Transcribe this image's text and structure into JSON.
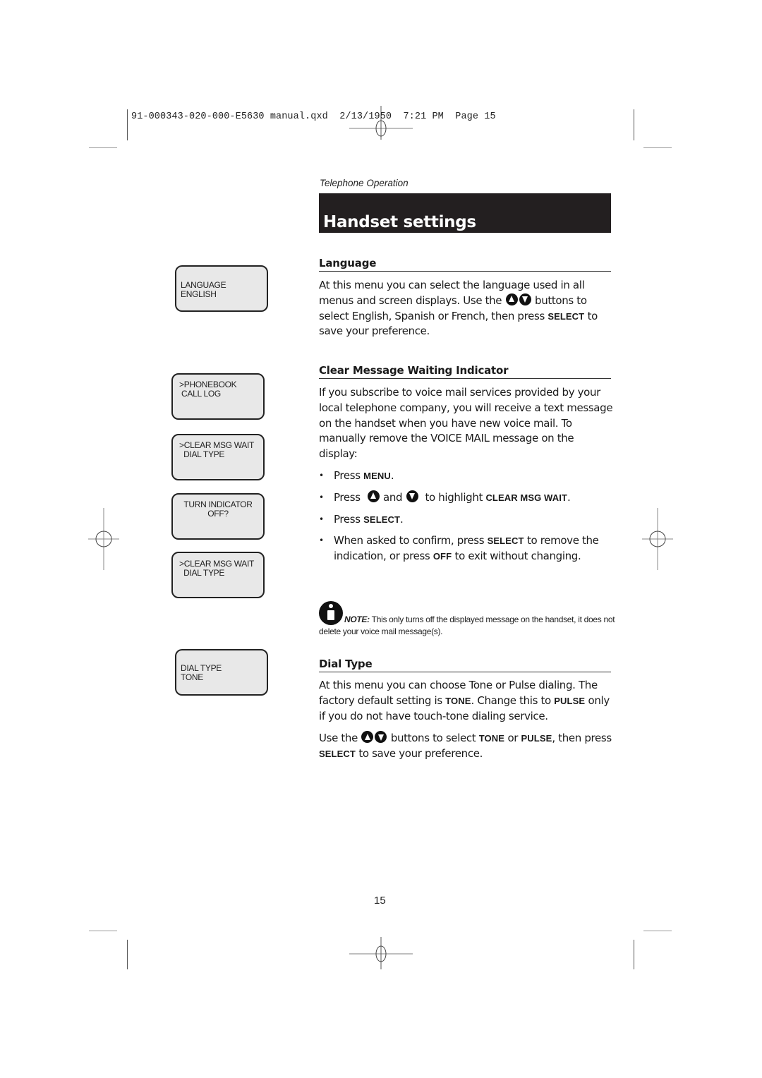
{
  "slug": "91-000343-020-000-E5630 manual.qxd  2/13/1950  7:21 PM  Page 15",
  "section_kicker": "Telephone Operation",
  "title": "Handset settings",
  "lcd_screens": [
    {
      "line1": "LANGUAGE",
      "line2": "ENGLISH"
    },
    {
      "line1": ">PHONEBOOK",
      "line2": " CALL LOG"
    },
    {
      "line1": ">CLEAR MSG WAIT",
      "line2": "  DIAL TYPE"
    },
    {
      "line1": "TURN INDICATOR",
      "line2": "OFF?"
    },
    {
      "line1": ">CLEAR MSG WAIT",
      "line2": "  DIAL TYPE"
    },
    {
      "line1": "DIAL TYPE",
      "line2": "TONE"
    }
  ],
  "language": {
    "heading": "Language",
    "p1": "At this menu you can select the language used in all menus and screen displays. Use the",
    "p2": "buttons to select English, Spanish or French, then press",
    "kw_select": "SELECT",
    "p3": "to save your preference."
  },
  "cmwi": {
    "heading": "Clear Message Waiting Indicator",
    "intro": "If you subscribe to voice mail services provided by your local telephone company, you will receive a text message on the handset when you have new voice mail. To manually remove the VOICE MAIL message on the display:",
    "steps": {
      "s1_pre": "Press",
      "s1_kw": "MENU",
      "s1_post": ".",
      "s2_pre": "Press",
      "s2_and": "and",
      "s2_mid": "to highlight",
      "s2_kw": "CLEAR MSG WAIT",
      "s2_post": ".",
      "s3_pre": "Press",
      "s3_kw": "SELECT",
      "s3_post": ".",
      "s4_pre": "When asked to confirm, press",
      "s4_kw1": "SELECT",
      "s4_mid": "to remove the indication, or press",
      "s4_kw2": "OFF",
      "s4_post": "to exit without changing."
    },
    "note_label": "NOTE:",
    "note_text": "This only turns off the displayed message on the handset, it does not delete your voice mail message(s)."
  },
  "dial_type": {
    "heading": "Dial Type",
    "p1a": "At this menu you can choose Tone or Pulse dialing. The factory default setting is",
    "kw_tone": "TONE",
    "p1b": ". Change this to",
    "kw_pulse": "PULSE",
    "p1c": "only if you do not have touch-tone dialing service.",
    "p2a": "Use the",
    "p2b": "buttons to select",
    "p2_or": "or",
    "p2c": ", then press",
    "kw_select": "SELECT",
    "p2d": "to save your preference."
  },
  "page_number": "15"
}
